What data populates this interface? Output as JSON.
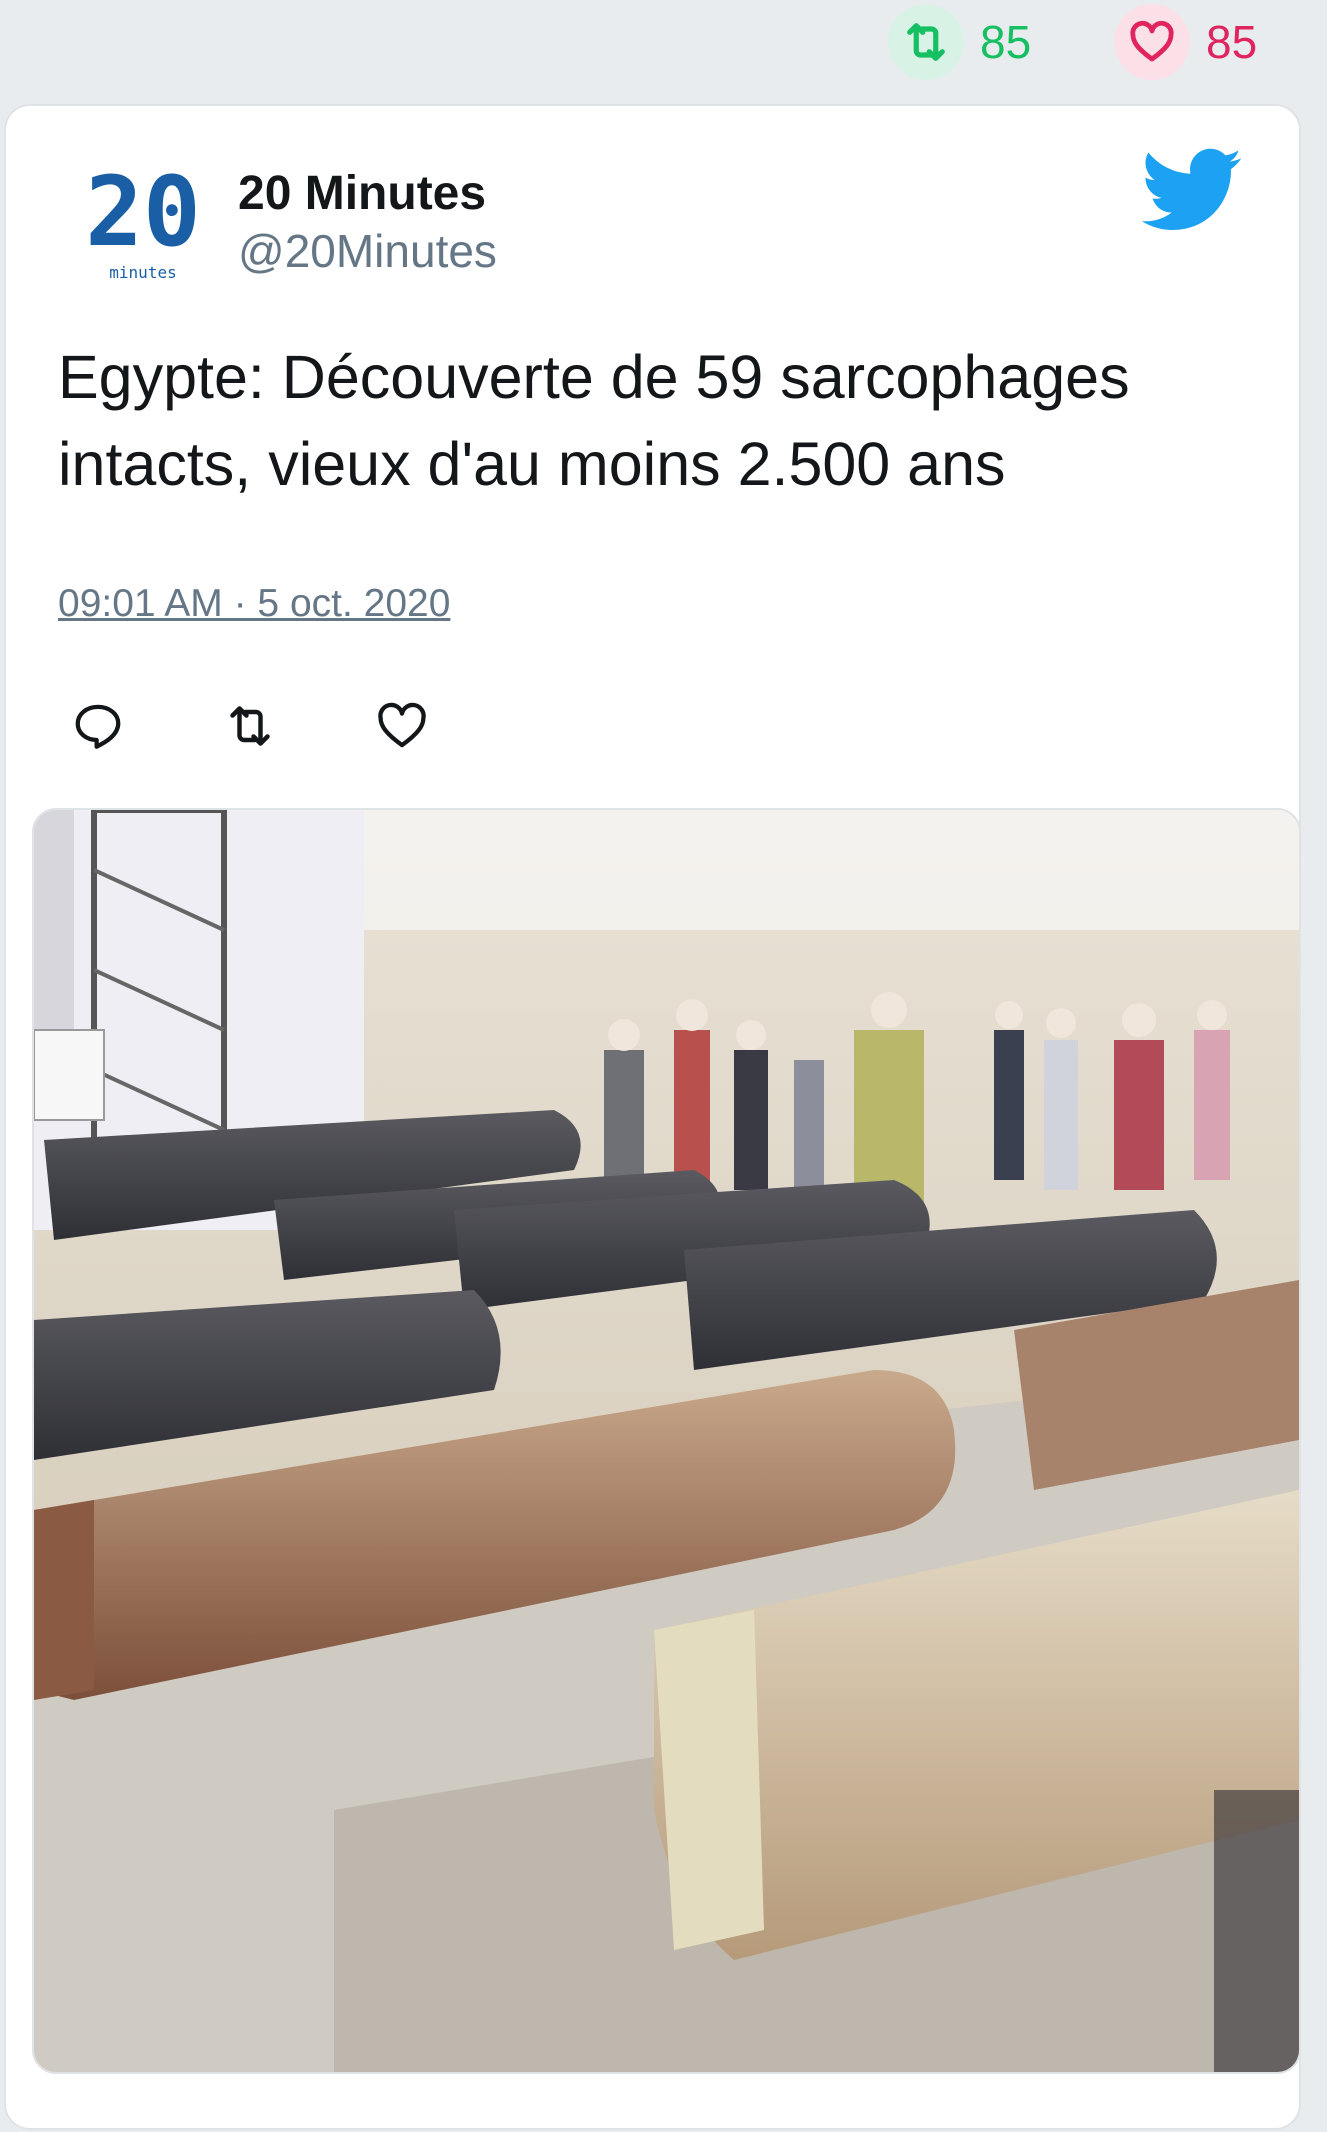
{
  "top_bar": {
    "retweet_count": "85",
    "like_count": "85",
    "retweet_icon": "retweet-icon",
    "like_icon": "heart-icon"
  },
  "tweet": {
    "author_name": "20 Minutes",
    "author_handle": "@20Minutes",
    "avatar_text": "20",
    "avatar_subtext": "minutes",
    "text_line1": "Egypte: Découverte de 59 sarcophages",
    "text_line2": "intacts, vieux d'au moins 2.500 ans",
    "timestamp": "09:01 AM · 5 oct. 2020",
    "actions": [
      "reply-icon",
      "retweet-icon",
      "heart-icon"
    ]
  },
  "colors": {
    "page_bg": "#e9ecef",
    "retweet_green": "#17bf63",
    "like_red": "#e0245e",
    "twitter_blue": "#1da1f2",
    "avatar_blue": "#1a5fa5"
  }
}
